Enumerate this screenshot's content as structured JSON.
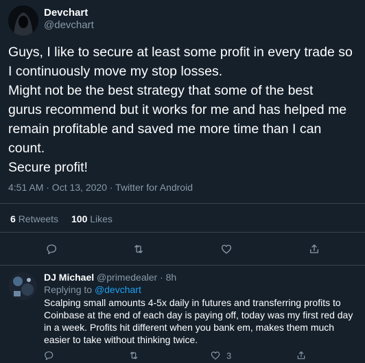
{
  "tweet": {
    "author_name": "Devchart",
    "author_handle": "@devchart",
    "lines": [
      "Guys, I like to secure at least some profit in every trade so",
      "I continuously move my stop losses.",
      "Might not be the best strategy that some of the best",
      "gurus recommend but it works for me and has helped me",
      "remain profitable and saved me more time than I can",
      "count.",
      "Secure profit!"
    ],
    "timestamp": "4:51 AM · Oct 13, 2020 · Twitter for Android",
    "retweets_count": "6",
    "retweets_label": "Retweets",
    "likes_count": "100",
    "likes_label": "Likes"
  },
  "reply": {
    "author_name": "DJ Michael",
    "author_handle": "@primedealer",
    "time": "· 8h",
    "replying_prefix": "Replying to",
    "replying_to": "@devchart",
    "lines": [
      "Scalping small amounts 4-5x daily in futures and transferring profits to",
      "Coinbase at the end of each day is paying off, today was my first red day",
      "in a week. Profits hit different when you bank em, makes them much",
      "easier to take without thinking twice."
    ],
    "like_count": "3"
  },
  "icons": {
    "reply": "reply-icon",
    "retweet": "retweet-icon",
    "like": "heart-icon",
    "share": "share-icon"
  },
  "colors": {
    "background": "#15202b",
    "divider": "#38444d",
    "muted": "#8899a6",
    "link": "#1da1f2"
  }
}
